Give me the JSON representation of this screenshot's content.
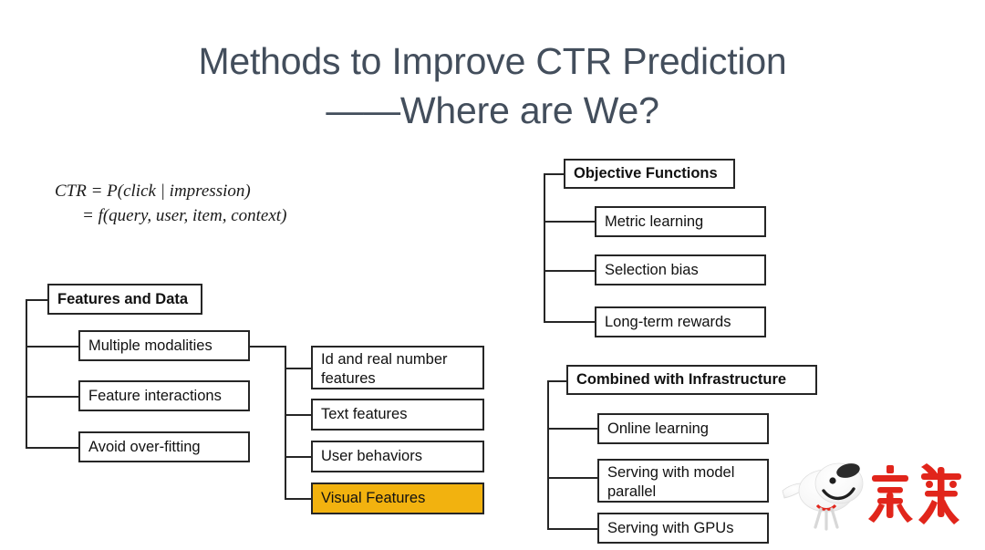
{
  "slide": {
    "title_line_1": "Methods to Improve CTR Prediction",
    "title_line_2": "——Where are We?",
    "title_color": "#434e5c",
    "background_color": "#ffffff"
  },
  "formula": {
    "line_1": "CTR = P(click | impression)",
    "line_2": "= f(query, user, item, context)"
  },
  "diagrams": {
    "features_and_data": {
      "root": "Features and Data",
      "children": [
        "Multiple modalities",
        "Feature interactions",
        "Avoid over-fitting"
      ],
      "sub_branch_parent": "Multiple modalities",
      "sub_children": [
        "Id and real number features",
        "Text features",
        "User behaviors",
        "Visual Features"
      ],
      "highlighted_child": "Visual Features",
      "highlight_color": "#f2b20f"
    },
    "objective_functions": {
      "root": "Objective Functions",
      "children": [
        "Metric learning",
        "Selection bias",
        "Long-term rewards"
      ]
    },
    "combined_with_infrastructure": {
      "root": "Combined with Infrastructure",
      "children": [
        "Online learning",
        "Serving with model parallel",
        "Serving with GPUs"
      ]
    }
  },
  "logo": {
    "name": "jd-logo",
    "wordmark": "京东",
    "wordmark_color": "#e1251b",
    "mascot_name": "joy-dog-mascot"
  }
}
